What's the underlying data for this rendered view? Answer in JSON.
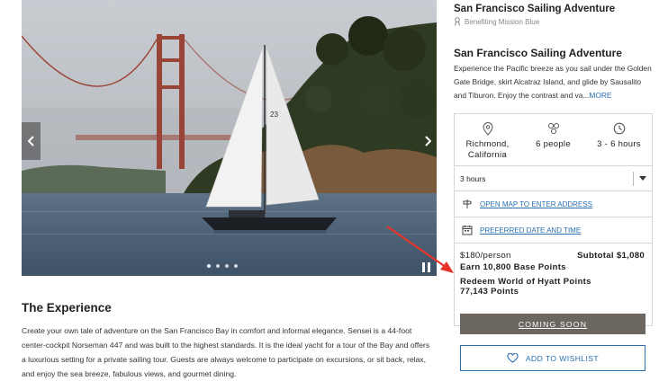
{
  "carousel": {
    "sail_number": "23",
    "slide_count": 4,
    "active_slide": 1
  },
  "header": {
    "title": "San Francisco Sailing Adventure",
    "benefit": "Benefiting Mission Blue"
  },
  "listing": {
    "title": "San Francisco Sailing Adventure",
    "description": "Experience the Pacific breeze as you sail under the Golden Gate Bridge, skirt Alcatraz Island, and glide by Sausalito and Tiburon. Enjoy the contrast and va...",
    "more_label": "MORE"
  },
  "stats": {
    "location": "Richmond, California",
    "people": "6 people",
    "duration": "3 - 6 hours",
    "icons": [
      "location-pin-icon",
      "people-icon",
      "clock-icon"
    ]
  },
  "booking": {
    "duration_select": "3 hours",
    "address_link": "OPEN MAP TO ENTER ADDRESS",
    "date_link": "PREFERRED DATE AND TIME",
    "price": "$180/person",
    "subtotal": "Subtotal $1,080",
    "earn_points": "Earn 10,800 Base Points",
    "redeem_label": "Redeem World of Hyatt Points",
    "redeem_points": "77,143 Points",
    "cta": "COMING SOON"
  },
  "wishlist": {
    "label": "ADD TO WISHLIST"
  },
  "experience": {
    "title": "The Experience",
    "text": "Create your own tale of adventure on the San Francisco Bay in comfort and informal elegance. Sensei is a 44-foot center-cockpit Norseman 447 and was built to the highest standards. It is the ideal yacht for a tour of the Bay and offers a luxurious setting for a private sailing tour. Guests are always welcome to participate on excursions, or sit back, relax, and enjoy the sea breeze, fabulous views, and gourmet dining."
  },
  "colors": {
    "link": "#2a6fb0",
    "cta_bg": "#6b6660",
    "arrow": "#e8342a"
  }
}
